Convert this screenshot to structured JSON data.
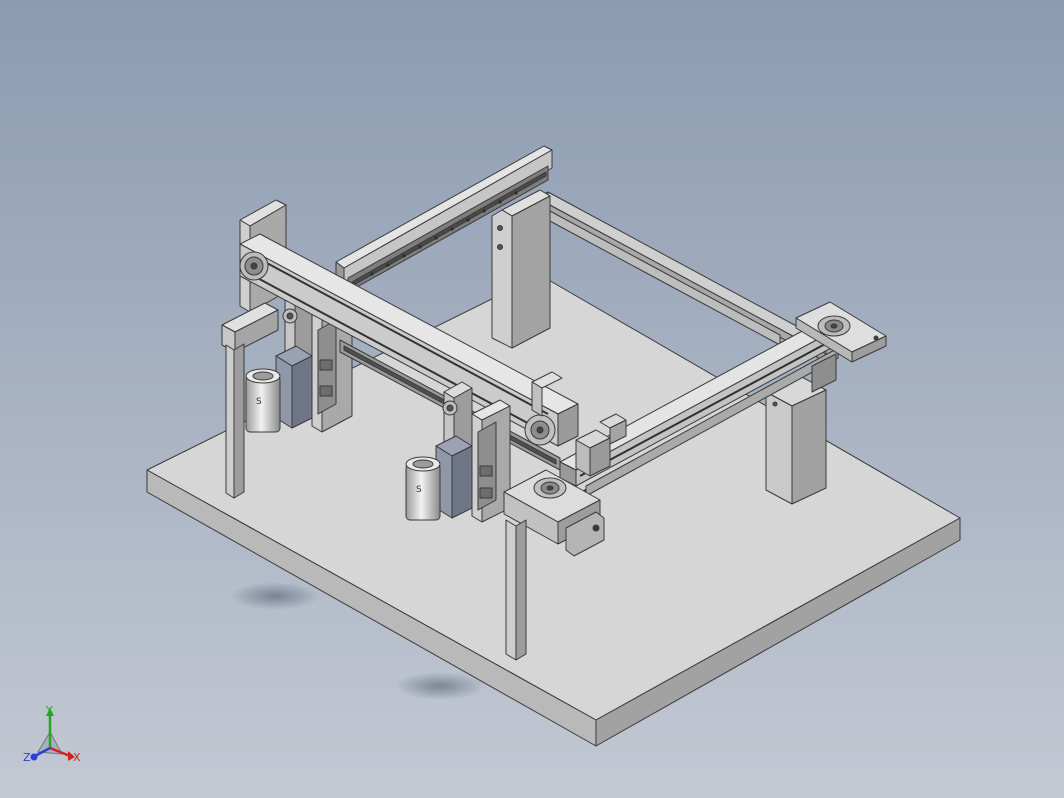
{
  "viewport": {
    "background_top": "#8c9bb1",
    "background_bottom": "#c3c9d3"
  },
  "model": {
    "part_face_color": "#d4d4d4",
    "part_side_color": "#a7a7a7",
    "edge_color": "#3a3a3a",
    "motor_color": "#e2e2e2"
  },
  "triad": {
    "x_label": "X",
    "y_label": "Y",
    "z_label": "Z",
    "x_color": "#d42020",
    "y_color": "#21a821",
    "z_color": "#2b3fd8"
  }
}
